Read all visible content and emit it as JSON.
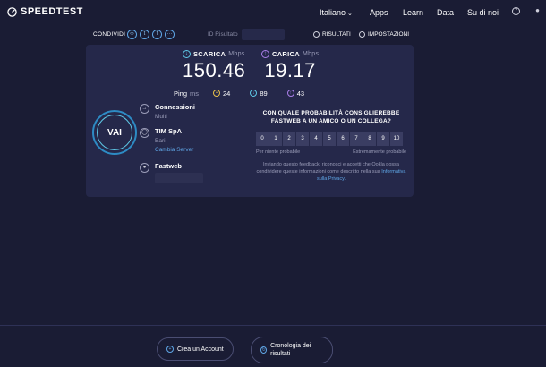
{
  "brand": {
    "name": "SPEEDTEST"
  },
  "nav": {
    "language": "Italiano",
    "apps": "Apps",
    "learn": "Learn",
    "data": "Data",
    "about": "Su di noi"
  },
  "share": {
    "label": "CONDIVIDI",
    "result_id_label": "ID Risultato"
  },
  "options": {
    "results": "RISULTATI",
    "settings": "IMPOSTAZIONI"
  },
  "download": {
    "label": "SCARICA",
    "unit": "Mbps",
    "value": "150.46"
  },
  "upload": {
    "label": "CARICA",
    "unit": "Mbps",
    "value": "19.17"
  },
  "ping": {
    "label": "Ping",
    "unit": "ms",
    "idle": "24",
    "download": "89",
    "upload": "43"
  },
  "go_button": "VAI",
  "connections": {
    "title": "Connessioni",
    "value": "Multi"
  },
  "server": {
    "name": "TIM SpA",
    "city": "Bari",
    "change": "Cambia Server"
  },
  "provider": {
    "name": "Fastweb"
  },
  "survey": {
    "question": "CON QUALE PROBABILITÀ CONSIGLIEREBBE FASTWEB A UN AMICO O UN COLLEGA?",
    "scale": [
      "0",
      "1",
      "2",
      "3",
      "4",
      "5",
      "6",
      "7",
      "8",
      "9",
      "10"
    ],
    "low": "Per niente probabile",
    "high": "Estremamente probabile",
    "note": "Inviando questo feedback, riconosci e accetti che Ookla possa condividere queste informazioni come descritto nella sua",
    "note_link": "Informativa sulla Privacy."
  },
  "bottom": {
    "create_account": "Crea un Account",
    "history": "Cronologia dei risultati"
  },
  "colors": {
    "background": "#1a1c34",
    "card": "#25284a",
    "download_accent": "#5ec8e6",
    "upload_accent": "#a97ee8",
    "link": "#5fa6e6"
  }
}
